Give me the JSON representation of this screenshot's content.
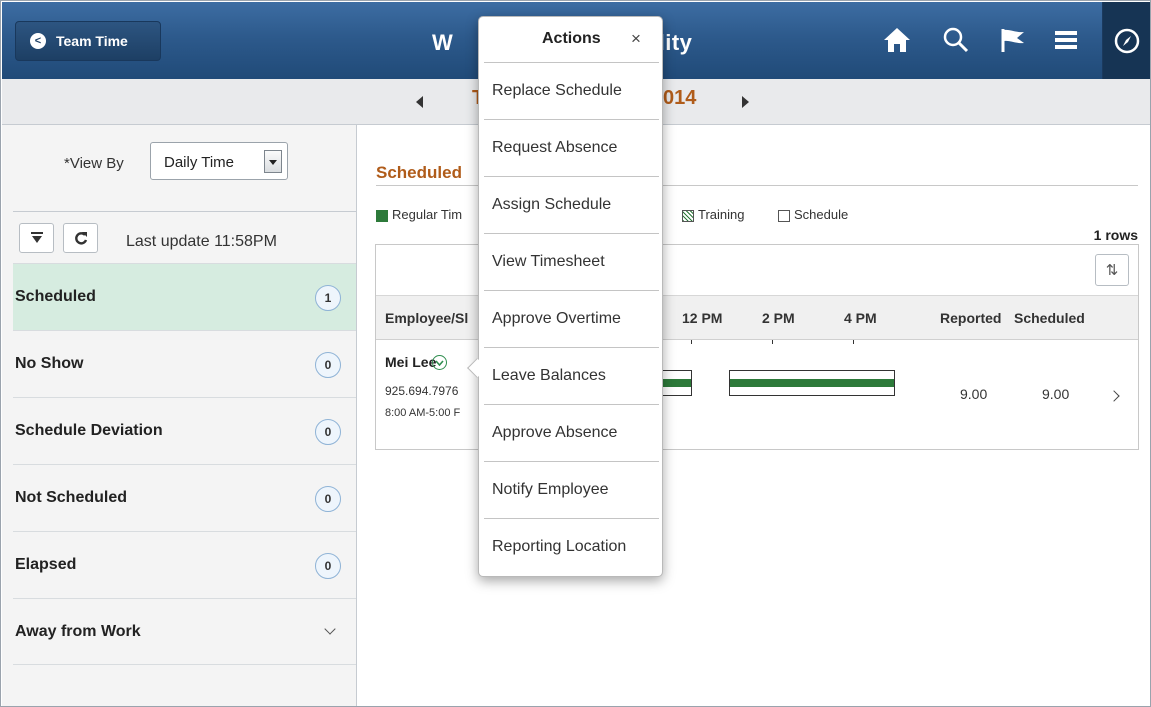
{
  "header": {
    "back_label": "Team Time",
    "title_left": "W",
    "title_right": "ility",
    "icons": [
      "home-icon",
      "search-icon",
      "flag-icon",
      "menu-icon",
      "navbar-icon"
    ]
  },
  "datebar": {
    "date_left": "T",
    "date_right": "014"
  },
  "view_by": {
    "label": "*View By",
    "value": "Daily Time"
  },
  "toolbar": {
    "last_update": "Last update 11:58PM"
  },
  "categories": [
    {
      "label": "Scheduled",
      "count": "1"
    },
    {
      "label": "No Show",
      "count": "0"
    },
    {
      "label": "Schedule Deviation",
      "count": "0"
    },
    {
      "label": "Not Scheduled",
      "count": "0"
    },
    {
      "label": "Elapsed",
      "count": "0"
    },
    {
      "label": "Away from Work",
      "count": ""
    }
  ],
  "section": {
    "title": "Scheduled",
    "legend_regular": "Regular Tim",
    "legend_training": "Training",
    "legend_schedule": "Schedule",
    "rows": "1 rows"
  },
  "grid": {
    "headers": [
      "Employee/Sl",
      "12 PM",
      "2 PM",
      "4 PM",
      "Reported",
      "Scheduled"
    ],
    "rows": [
      {
        "name": "Mei Lee",
        "phone": "925.694.7976",
        "shift": "8:00 AM-5:00 F",
        "reported": "9.00",
        "scheduled": "9.00"
      }
    ]
  },
  "actions_popover": {
    "title": "Actions",
    "close": "×",
    "items": [
      "Replace Schedule",
      "Request Absence",
      "Assign Schedule",
      "View Timesheet",
      "Approve Overtime",
      "Leave Balances",
      "Approve Absence",
      "Notify Employee",
      "Reporting Location"
    ]
  },
  "colors": {
    "banner": "#2d5a8c",
    "accent_text": "#b05c1a",
    "active_row": "#d6ece0",
    "bar_green": "#2d7a3a"
  }
}
